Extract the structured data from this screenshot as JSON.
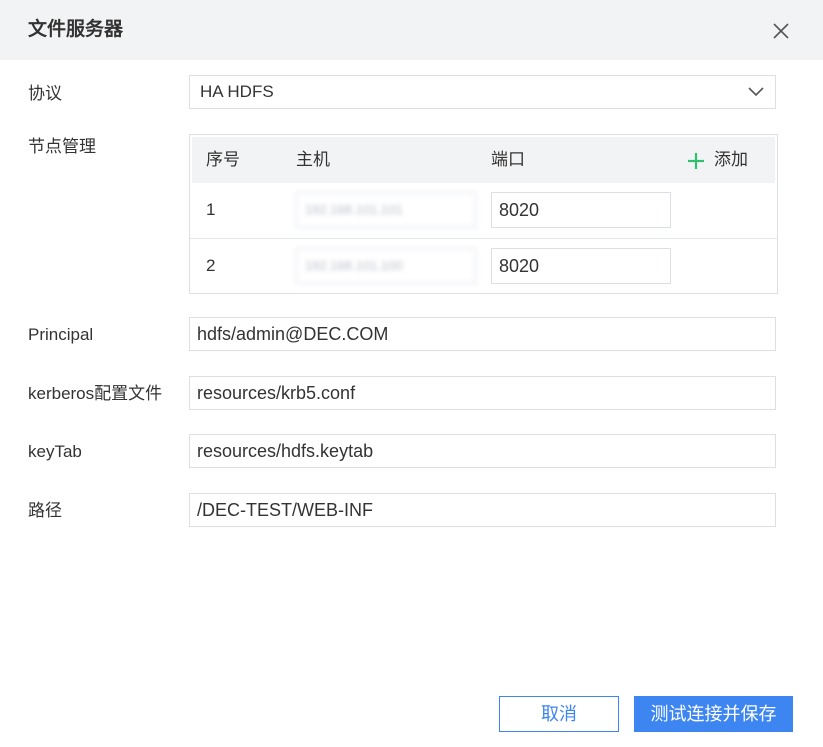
{
  "dialog": {
    "title": "文件服务器"
  },
  "icons": {
    "close": "close-icon",
    "dropdown": "chevron-down-icon",
    "add": "plus-icon"
  },
  "colors": {
    "primary": "#3d85f0",
    "add_icon": "#2fbf6e",
    "header_bg": "#f2f3f5",
    "border": "#dcdfe6"
  },
  "protocol": {
    "label": "协议",
    "value": "HA HDFS"
  },
  "nodes": {
    "label": "节点管理",
    "headers": {
      "index": "序号",
      "host": "主机",
      "port": "端口"
    },
    "add_label": "添加",
    "rows": [
      {
        "index": "1",
        "host": "192.168.101.101",
        "port": "8020"
      },
      {
        "index": "2",
        "host": "192.168.101.100",
        "port": "8020"
      }
    ]
  },
  "principal": {
    "label": "Principal",
    "value": "hdfs/admin@DEC.COM"
  },
  "kerberos": {
    "label": "kerberos配置文件",
    "value": "resources/krb5.conf"
  },
  "keytab": {
    "label": "keyTab",
    "value": "resources/hdfs.keytab"
  },
  "path": {
    "label": "路径",
    "value": "/DEC-TEST/WEB-INF"
  },
  "footer": {
    "cancel_label": "取消",
    "save_label": "测试连接并保存"
  }
}
